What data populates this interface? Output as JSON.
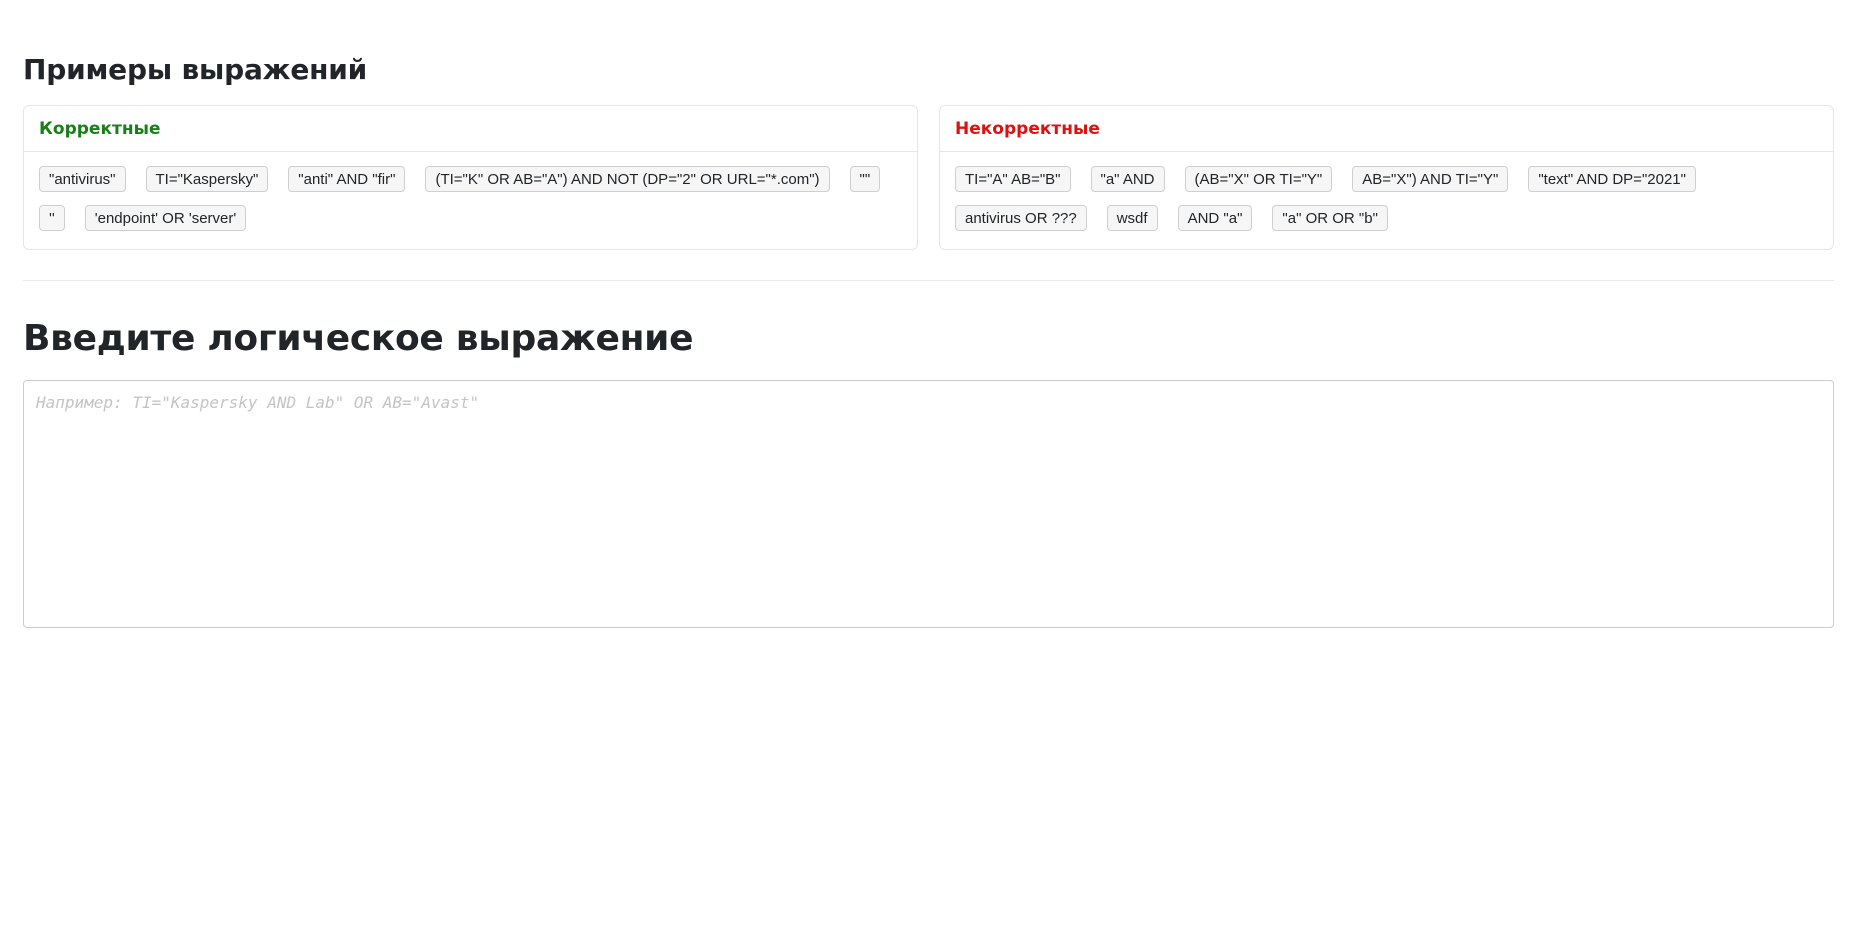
{
  "examples": {
    "title": "Примеры выражений",
    "valid": {
      "header": "Корректные",
      "items": [
        "\"antivirus\"",
        "TI=\"Kaspersky\"",
        "\"anti\" AND \"fir\"",
        "(TI=\"K\" OR AB=\"A\") AND NOT (DP=\"2\" OR URL=\"*.com\")",
        "\"\"",
        "''",
        "'endpoint' OR 'server'"
      ]
    },
    "invalid": {
      "header": "Некорректные",
      "items": [
        "TI=\"A\" AB=\"B\"",
        "\"a\" AND",
        "(AB=\"X\" OR TI=\"Y\"",
        "AB=\"X\") AND TI=\"Y\"",
        "\"text\" AND DP=\"2021\"",
        "antivirus OR ???",
        "wsdf",
        "AND \"a\"",
        "\"a\" OR OR \"b\""
      ]
    }
  },
  "input_section": {
    "title": "Введите логическое выражение",
    "placeholder": "Например: TI=\"Kaspersky AND Lab\" OR AB=\"Avast\"",
    "value": ""
  },
  "colors": {
    "valid": "#198019",
    "invalid": "#e01010"
  }
}
